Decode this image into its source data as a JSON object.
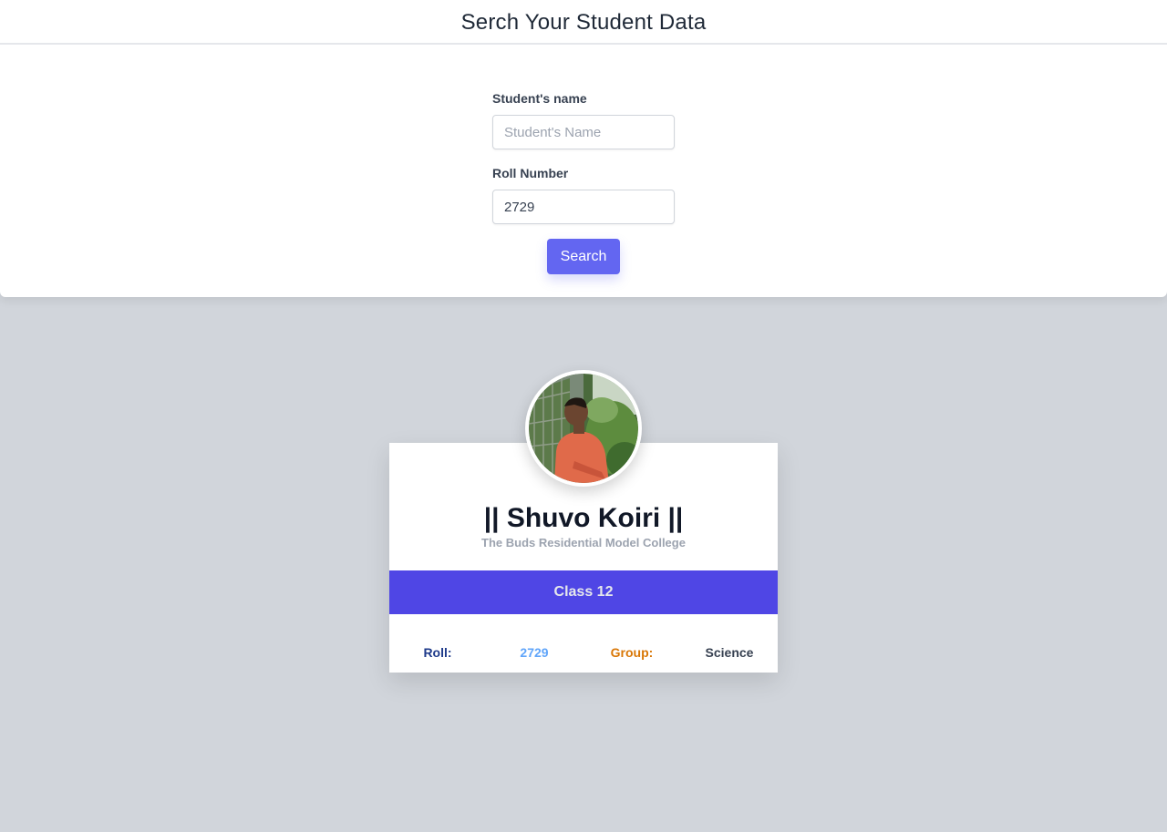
{
  "header": {
    "title": "Serch Your Student Data"
  },
  "form": {
    "name_label": "Student's name",
    "name_placeholder": "Student's Name",
    "name_value": "",
    "roll_label": "Roll Number",
    "roll_value": "2729",
    "search_label": "Search"
  },
  "card": {
    "avatar_icon": "student-photo",
    "student_name": "|| Shuvo Koiri ||",
    "college": "The Buds Residential Model College",
    "class_label": "Class 12",
    "roll_label": "Roll:",
    "roll_value": "2729",
    "group_label": "Group:",
    "group_value": "Science"
  },
  "colors": {
    "accent": "#6366f1",
    "class_bar": "#4f46e5",
    "background": "#d1d5db",
    "roll_label": "#1e3a8a",
    "roll_value": "#60a5fa",
    "group_label": "#d97706"
  }
}
